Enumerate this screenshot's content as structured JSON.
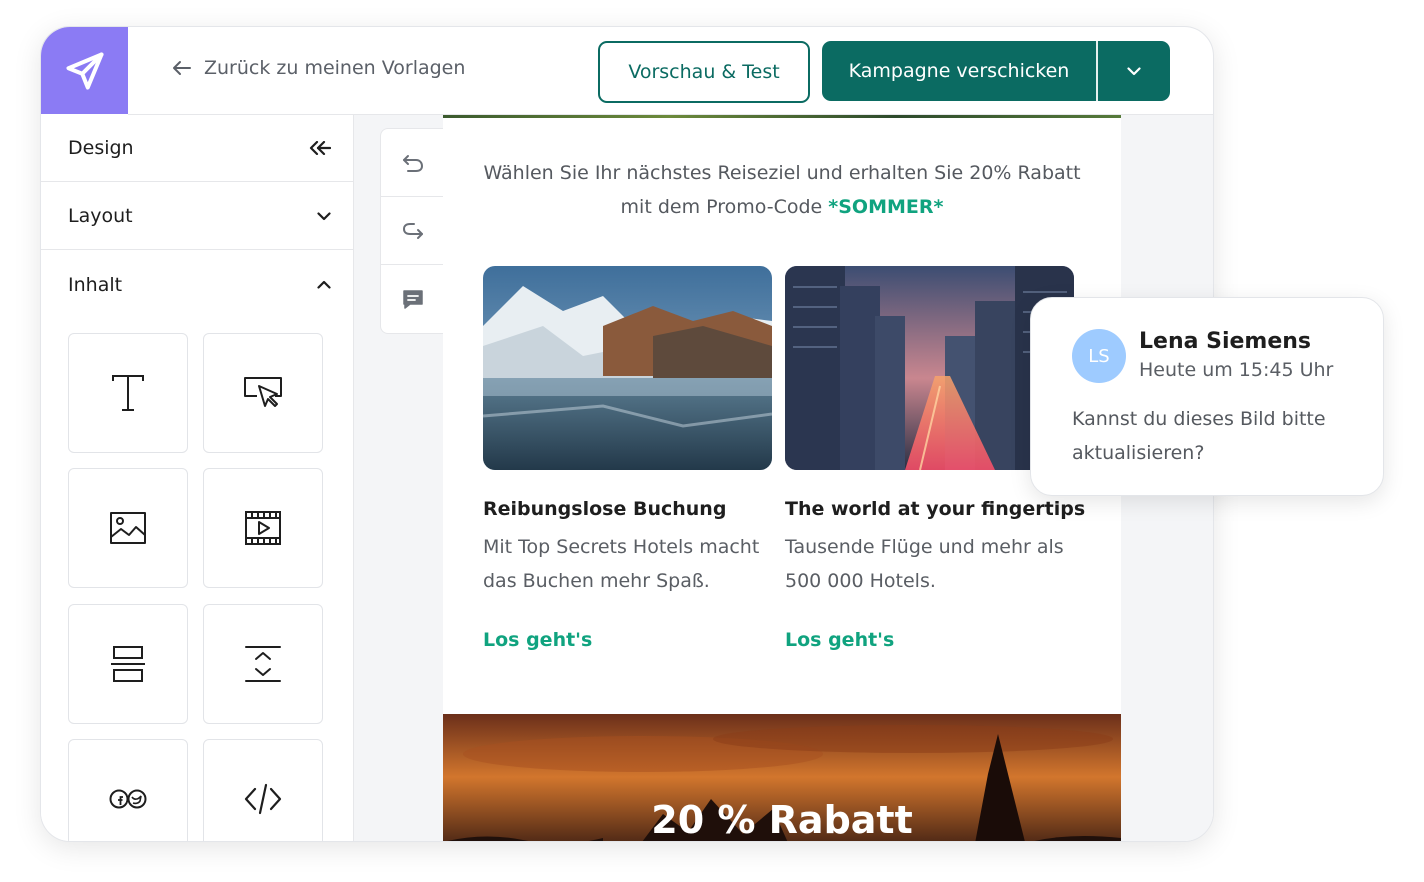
{
  "header": {
    "back_label": "Zurück zu meinen Vorlagen",
    "preview_label": "Vorschau & Test",
    "send_label": "Kampagne verschicken"
  },
  "sidebar": {
    "sections": [
      {
        "label": "Design",
        "icon": "double-chevron-left-icon"
      },
      {
        "label": "Layout",
        "icon": "chevron-down-icon"
      },
      {
        "label": "Inhalt",
        "icon": "chevron-up-icon"
      }
    ],
    "blocks": [
      "text-icon",
      "button-icon",
      "image-icon",
      "video-icon",
      "divider-icon",
      "spacer-icon",
      "social-icon",
      "html-code-icon"
    ]
  },
  "tools": [
    "undo-icon",
    "redo-icon",
    "comment-icon"
  ],
  "email": {
    "promo_line1": "Wählen Sie Ihr nächstes Reiseziel und erhalten Sie 20% Rabatt",
    "promo_line2_prefix": "mit dem Promo-Code ",
    "promo_code": "*SOMMER*",
    "cards": [
      {
        "title": "Reibungslose Buchung",
        "text_line1": "Mit Top Secrets Hotels macht",
        "text_line2": "das Buchen mehr Spaß.",
        "link": "Los geht's"
      },
      {
        "title": "The world at your fingertips",
        "text_line1": "Tausende Flüge und mehr als",
        "text_line2": "500 000 Hotels.",
        "link": "Los geht's"
      }
    ],
    "banner_title": "20 % Rabatt"
  },
  "comment": {
    "initials": "LS",
    "name": "Lena Siemens",
    "time": "Heute um 15:45 Uhr",
    "text_line1": "Kannst du dieses Bild bitte",
    "text_line2": "aktualisieren?"
  },
  "colors": {
    "brand_purple": "#8b7bf4",
    "primary_green": "#0b6b62",
    "accent_green": "#10a37f",
    "avatar_blue": "#9ecbff"
  }
}
